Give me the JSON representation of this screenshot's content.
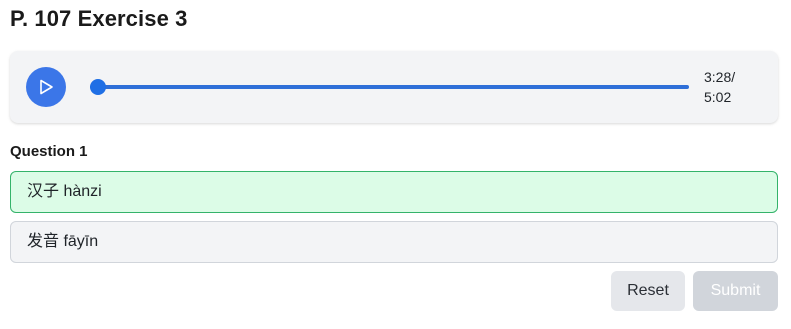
{
  "page": {
    "title": "P. 107 Exercise 3"
  },
  "audio": {
    "play_icon": "play-icon",
    "current_time": "3:28/",
    "total_time": "5:02",
    "progress": 0.0,
    "accent_color": "#3b76e8"
  },
  "question": {
    "label": "Question 1",
    "options": [
      {
        "text": "汉子 hànzi",
        "state": "selected"
      },
      {
        "text": "发音 fāyīn",
        "state": "default"
      }
    ]
  },
  "actions": {
    "reset_label": "Reset",
    "submit_label": "Submit",
    "submit_disabled": true
  }
}
